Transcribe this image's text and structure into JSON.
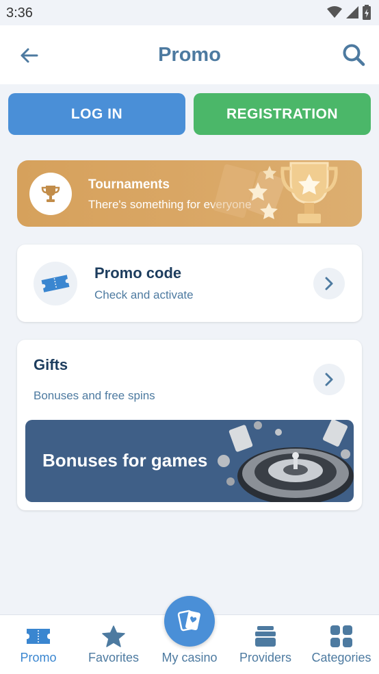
{
  "status_bar": {
    "time": "3:36"
  },
  "header": {
    "title": "Promo"
  },
  "auth": {
    "login_label": "LOG IN",
    "registration_label": "REGISTRATION"
  },
  "tournaments": {
    "title": "Tournaments",
    "subtitle": "There's something for everyone"
  },
  "promo_code": {
    "title": "Promo code",
    "subtitle": "Check and activate"
  },
  "gifts": {
    "title": "Gifts",
    "subtitle": "Bonuses and free spins",
    "banner_text": "Bonuses for games"
  },
  "bottom_nav": {
    "items": [
      {
        "label": "Promo",
        "icon": "ticket-icon",
        "active": true
      },
      {
        "label": "Favorites",
        "icon": "star-icon",
        "active": false
      },
      {
        "label": "My casino",
        "icon": "cards-icon",
        "active": false
      },
      {
        "label": "Providers",
        "icon": "stack-icon",
        "active": false
      },
      {
        "label": "Categories",
        "icon": "grid-icon",
        "active": false
      }
    ]
  },
  "colors": {
    "primary_blue": "#4a8fd7",
    "green": "#4bb769",
    "gold": "#d6a15c",
    "banner_blue": "#3f5f87",
    "text_dark": "#1d3d5e",
    "text_muted": "#4d7aa0"
  }
}
